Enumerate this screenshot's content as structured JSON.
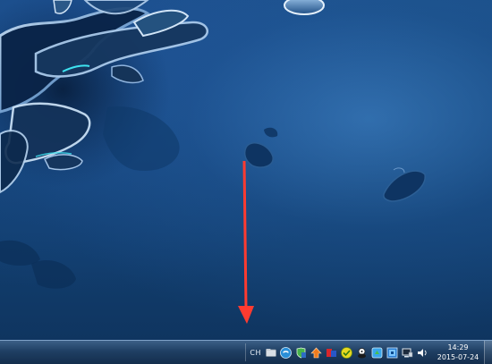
{
  "screen": {
    "wallpaper": "blue-water-splash",
    "annotation_color": "#ff3b30"
  },
  "taskbar": {
    "language_indicator": "CH",
    "tray_icons": [
      {
        "name": "folder-icon"
      },
      {
        "name": "browser-icon"
      },
      {
        "name": "security-shield-icon"
      },
      {
        "name": "download-icon"
      },
      {
        "name": "antivirus-icon"
      },
      {
        "name": "green-circle-icon"
      },
      {
        "name": "messenger-icon"
      },
      {
        "name": "sync-icon"
      },
      {
        "name": "app-square-icon"
      },
      {
        "name": "network-icon"
      },
      {
        "name": "volume-icon"
      }
    ],
    "clock": {
      "time": "14:29",
      "date": "2015-07-24"
    }
  }
}
